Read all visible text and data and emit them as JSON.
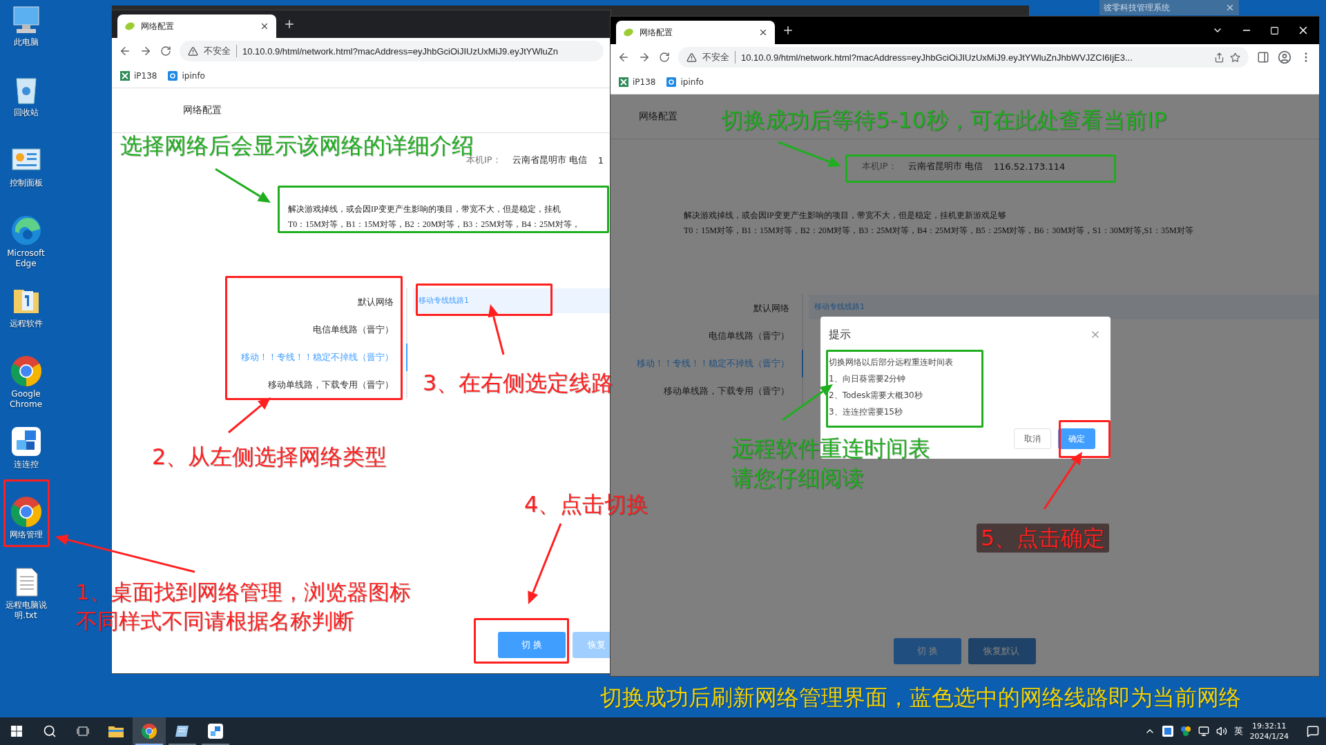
{
  "desktop_icons": [
    {
      "label": "此电脑"
    },
    {
      "label": "回收站"
    },
    {
      "label": "控制面板"
    },
    {
      "label": "Microsoft Edge"
    },
    {
      "label": "远程软件"
    },
    {
      "label": "Google Chrome"
    },
    {
      "label": "连连控"
    },
    {
      "label": "网络管理"
    },
    {
      "label": "远程电脑说明.txt"
    }
  ],
  "background_window": {
    "title": "彼零科技管理系统"
  },
  "left_browser": {
    "tab_title": "网络配置",
    "security": "不安全",
    "url": "10.10.0.9/html/network.html?macAddress=eyJhbGciOiJIUzUxMiJ9.eyJtYWluZn",
    "bookmarks": [
      "iP138",
      "ipinfo"
    ],
    "page": {
      "heading": "网络配置",
      "ip_label": "本机IP：",
      "ip_location": "云南省昆明市 电信",
      "ip_address": "1",
      "description": [
        "解决游戏掉线，或会因IP变更产生影响的项目，带宽不大，但是稳定，挂机",
        "T0：15M对等，B1：15M对等，B2：20M对等，B3：25M对等，B4：25M对等，"
      ],
      "network_types": [
        {
          "label": "默认网络",
          "selected": false
        },
        {
          "label": "电信单线路（晋宁）",
          "selected": false
        },
        {
          "label": "移动！！专线！！稳定不掉线（晋宁）",
          "selected": true
        },
        {
          "label": "移动单线路，下载专用（晋宁）",
          "selected": false
        }
      ],
      "lines": [
        {
          "label": "移动专线线路1",
          "selected": true
        }
      ],
      "buttons": [
        "切 换",
        "恢复"
      ]
    }
  },
  "right_browser": {
    "tab_title": "网络配置",
    "security": "不安全",
    "url": "10.10.0.9/html/network.html?macAddress=eyJhbGciOiJIUzUxMiJ9.eyJtYWluZnJhbWVJZCI6IjE3...",
    "bookmarks": [
      "iP138",
      "ipinfo"
    ],
    "page": {
      "heading": "网络配置",
      "ip_label": "本机IP：",
      "ip_location": "云南省昆明市 电信",
      "ip_address": "116.52.173.114",
      "description": [
        "解决游戏掉线，或会因IP变更产生影响的项目，带宽不大，但是稳定，挂机更新游戏足够",
        "T0：15M对等，B1：15M对等，B2：20M对等，B3：25M对等，B4：25M对等，B5：25M对等，B6：30M对等，S1：30M对等,S1：35M对等"
      ],
      "network_types": [
        {
          "label": "默认网络",
          "selected": false
        },
        {
          "label": "电信单线路（晋宁）",
          "selected": false
        },
        {
          "label": "移动！！专线！！稳定不掉线（晋宁）",
          "selected": true
        },
        {
          "label": "移动单线路，下载专用（晋宁）",
          "selected": false
        }
      ],
      "lines": [
        {
          "label": "移动专线线路1",
          "selected": true
        }
      ],
      "buttons": [
        "切 换",
        "恢复默认"
      ]
    },
    "dialog": {
      "title": "提示",
      "lines": [
        "切换网络以后部分远程重连时间表",
        "1、向日葵需要2分钟",
        "2、Todesk需要大概30秒",
        "3、连连控需要15秒"
      ],
      "cancel": "取消",
      "confirm": "确定"
    }
  },
  "annotations": [
    {
      "text": "选择网络后会显示该网络的详细介绍",
      "color": "#1fae1f"
    },
    {
      "text": "3、在右侧选定线路",
      "color": "#ff1f1f"
    },
    {
      "text": "2、从左侧选择网络类型",
      "color": "#ff1f1f"
    },
    {
      "text": "4、点击切换",
      "color": "#ff1f1f"
    },
    {
      "text": "1、桌面找到网络管理，浏览器图标",
      "color": "#ff1f1f"
    },
    {
      "text": "不同样式不同请根据名称判断",
      "color": "#ff1f1f"
    },
    {
      "text": "切换成功后等待5-10秒，可在此处查看当前IP",
      "color": "#1fae1f"
    },
    {
      "text": "远程软件重连时间表",
      "color": "#1fae1f"
    },
    {
      "text": "请您仔细阅读",
      "color": "#1fae1f"
    },
    {
      "text": "5、点击确定",
      "color": "#ff1f1f"
    },
    {
      "text": "切换成功后刷新网络管理界面，蓝色选中的网络线路即为当前网络",
      "color": "#f5d200"
    }
  ],
  "taskbar": {
    "apps": [
      {
        "selected": false
      },
      {
        "selected": true
      },
      {
        "selected": false
      },
      {
        "selected": false
      }
    ],
    "ime": "英",
    "time": "19:32:11",
    "date": "2024/1/24"
  }
}
